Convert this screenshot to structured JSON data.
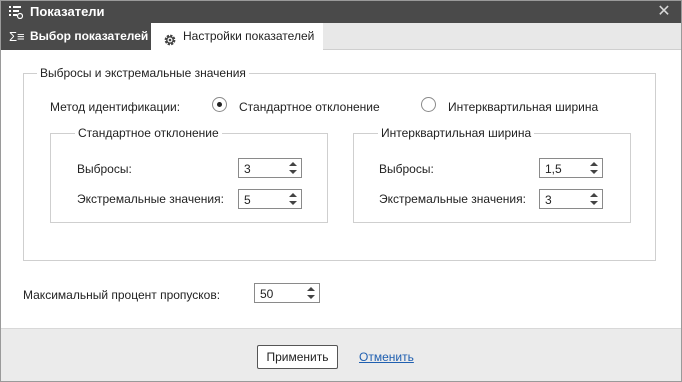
{
  "window": {
    "title": "Показатели",
    "title_icon": "list-settings-icon",
    "close_icon": "close-icon"
  },
  "tabs": [
    {
      "label": "Выбор показателей",
      "icon": "sigma-icon",
      "active": false
    },
    {
      "label": "Настройки показателей",
      "icon": "gear-icon",
      "active": true
    }
  ],
  "outliers_group": {
    "title": "Выбросы и экстремальные значения",
    "method_label": "Метод идентификации:",
    "methods": [
      {
        "label": "Стандартное отклонение",
        "selected": true
      },
      {
        "label": "Интерквартильная ширина",
        "selected": false
      }
    ],
    "std_group": {
      "title": "Стандартное отклонение",
      "outliers_label": "Выбросы:",
      "outliers_value": "3",
      "extreme_label": "Экстремальные значения:",
      "extreme_value": "5"
    },
    "iqr_group": {
      "title": "Интерквартильная ширина",
      "outliers_label": "Выбросы:",
      "outliers_value": "1,5",
      "extreme_label": "Экстремальные значения:",
      "extreme_value": "3"
    }
  },
  "max_missing": {
    "label": "Максимальный процент пропусков:",
    "value": "50"
  },
  "footer": {
    "apply_label": "Применить",
    "cancel_label": "Отменить"
  }
}
